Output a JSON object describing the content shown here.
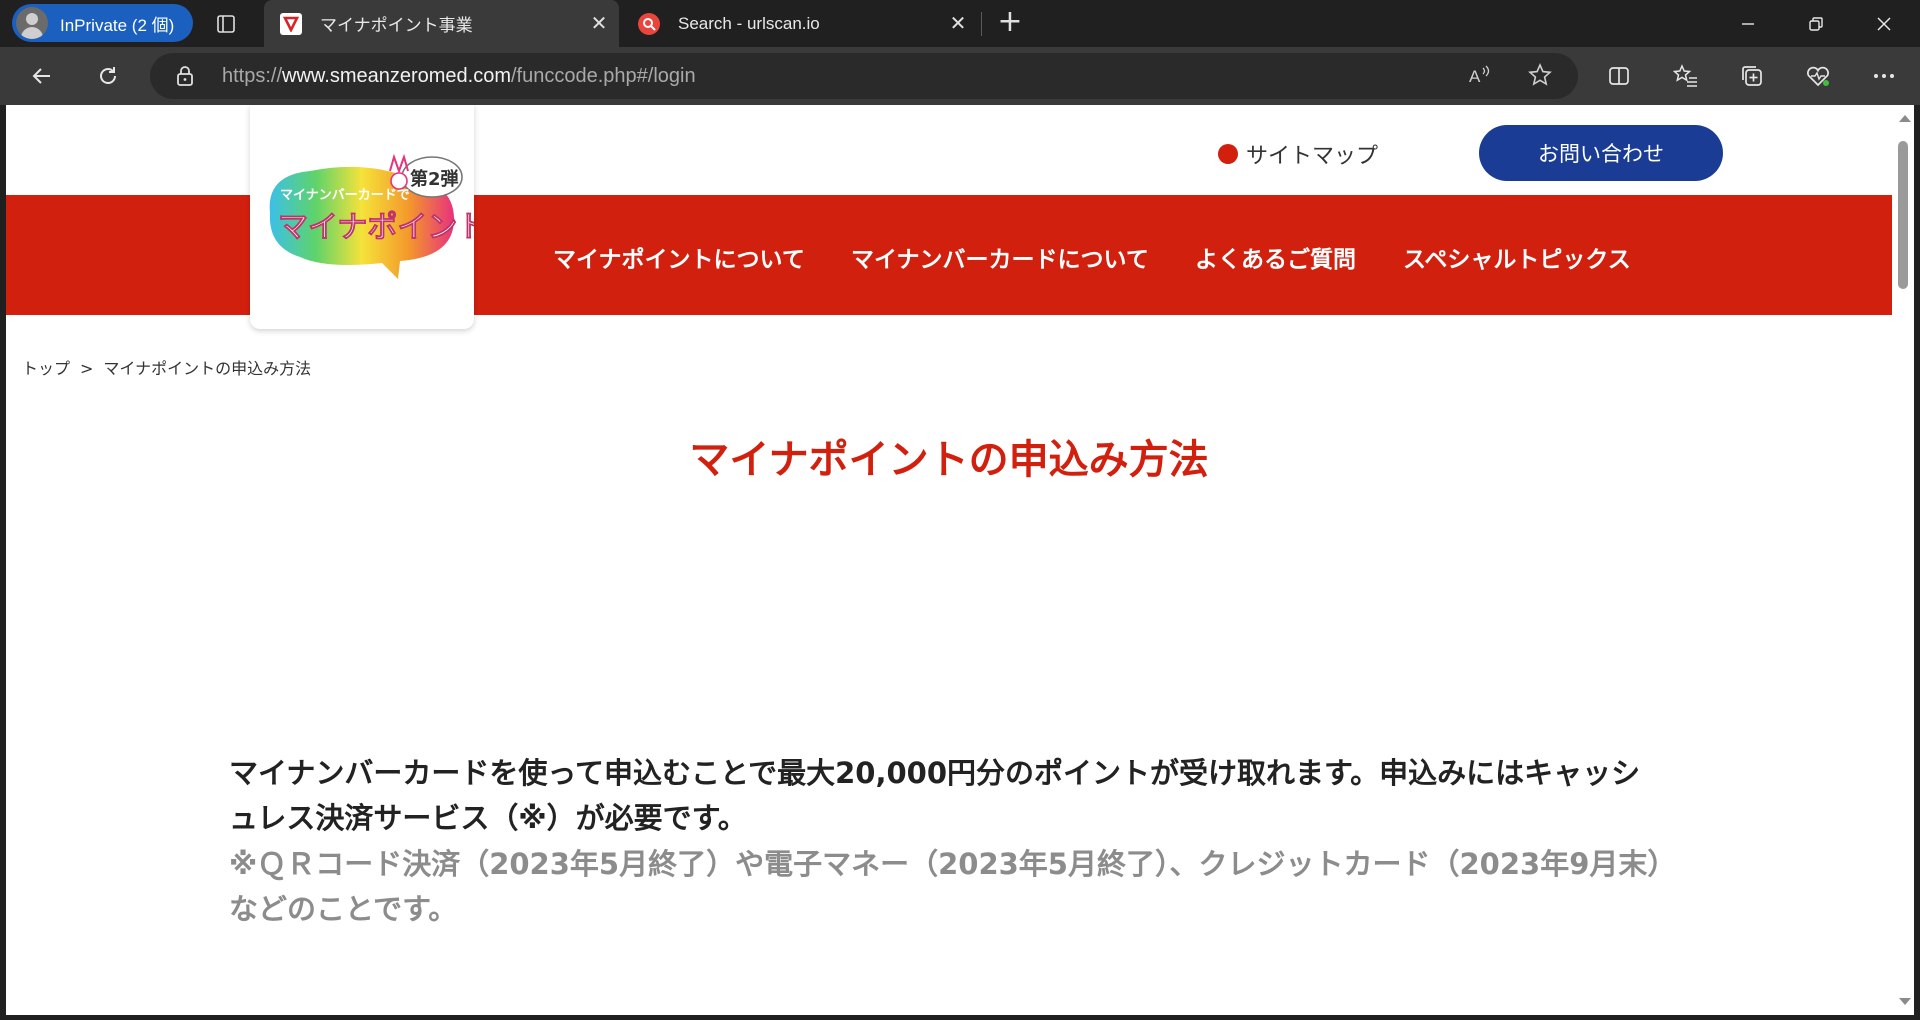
{
  "browser": {
    "profile_label": "InPrivate (2 個)",
    "tabs": [
      {
        "title": "マイナポイント事業",
        "favicon": "mynapoint-favicon",
        "active": true
      },
      {
        "title": "Search - urlscan.io",
        "favicon": "urlscan-favicon",
        "active": false
      }
    ],
    "url_scheme": "https://",
    "url_host": "www.smeanzeromed.com",
    "url_path": "/funccode.php#/login"
  },
  "site": {
    "logo_alt": "マイナポイント 第2弾",
    "sitemap_label": "サイトマップ",
    "contact_label": "お問い合わせ",
    "nav": [
      "マイナポイントについて",
      "マイナンバーカードについて",
      "よくあるご質問",
      "スペシャルトピックス"
    ],
    "breadcrumb": {
      "home": "トップ",
      "separator": ">",
      "current": "マイナポイントの申込み方法"
    },
    "title": "マイナポイントの申込み方法",
    "intro": "マイナンバーカードを使って申込むことで最大20,000円分のポイントが受け取れます。申込みにはキャッシュレス決済サービス（※）が必要です。",
    "note": "※ＱＲコード決済（2023年5月終了）や電子マネー（2023年5月終了）、クレジットカード（2023年9月末）などのことです。"
  },
  "colors": {
    "brand_red": "#d2200f",
    "contact_blue": "#1a3c94",
    "browser_dark": "#202020"
  }
}
